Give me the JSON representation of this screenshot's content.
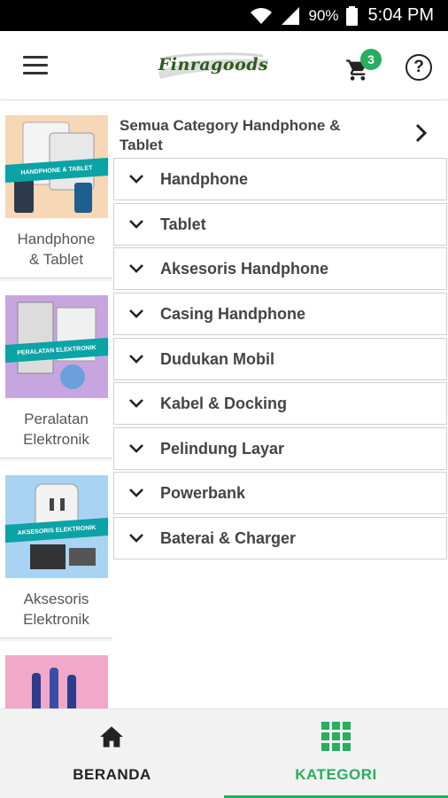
{
  "status_bar": {
    "battery": "90%",
    "time": "5:04 PM"
  },
  "header": {
    "logo_text": "Finragoods",
    "cart_count": "3",
    "help_symbol": "?"
  },
  "sidebar": {
    "items": [
      {
        "label_line1": "Handphone",
        "label_line2": "& Tablet",
        "ribbon": "HANDPHONE & TABLET",
        "color": "#f6d7b6"
      },
      {
        "label_line1": "Peralatan",
        "label_line2": "Elektronik",
        "ribbon": "PERALATAN ELEKTRONIK",
        "color": "#c7a6e0"
      },
      {
        "label_line1": "Aksesoris",
        "label_line2": "Elektronik",
        "ribbon": "AKSESORIS ELEKTRONIK",
        "color": "#a9d3f2"
      },
      {
        "label_line1": "",
        "label_line2": "",
        "ribbon": "",
        "color": "#f1a9c9"
      }
    ]
  },
  "content": {
    "all_label": "Semua Category Handphone & Tablet",
    "categories": [
      "Handphone",
      "Tablet",
      "Aksesoris Handphone",
      "Casing Handphone",
      "Dudukan Mobil",
      "Kabel & Docking",
      "Pelindung Layar",
      "Powerbank",
      "Baterai & Charger"
    ]
  },
  "bottom_nav": {
    "tabs": [
      {
        "label": "BERANDA",
        "icon": "home-icon",
        "active": false
      },
      {
        "label": "KATEGORI",
        "icon": "grid-icon",
        "active": true
      }
    ],
    "active_color": "#27ae60",
    "inactive_color": "#222222"
  }
}
